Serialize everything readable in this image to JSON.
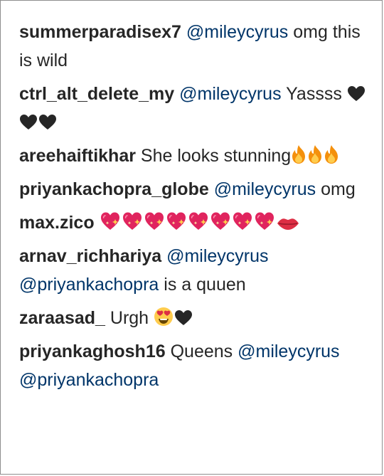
{
  "comments": [
    {
      "user": "summerparadisex7",
      "mention": "@mileycyrus",
      "text": "omg this is wild"
    },
    {
      "user": "ctrl_alt_delete_my",
      "mention": "@mileycyrus",
      "text": "Yassss"
    },
    {
      "user": "areehaiftikhar",
      "text": "She looks stunning"
    },
    {
      "user": "priyankachopra_globe",
      "mention": "@mileycyrus",
      "text": "omg"
    },
    {
      "user": "max.zico"
    },
    {
      "user": "arnav_richhariya",
      "mention": "@mileycyrus",
      "mention2": "@priyankachopra",
      "text": "is a quuen"
    },
    {
      "user": "zaraasad_",
      "text": "Urgh"
    },
    {
      "user": "priyankaghosh16",
      "text": "Queens",
      "mention": "@mileycyrus",
      "mention2": "@priyankachopra"
    }
  ],
  "emoji_icons": {
    "black_heart": "black-heart-icon",
    "fire": "fire-icon",
    "sparkling_heart": "sparkling-heart-icon",
    "kiss_lips": "kiss-lips-icon",
    "heart_eyes": "heart-eyes-face-icon"
  },
  "colors": {
    "username": "#262626",
    "mention": "#003569",
    "text": "#262626",
    "border": "#8e8e8e"
  }
}
